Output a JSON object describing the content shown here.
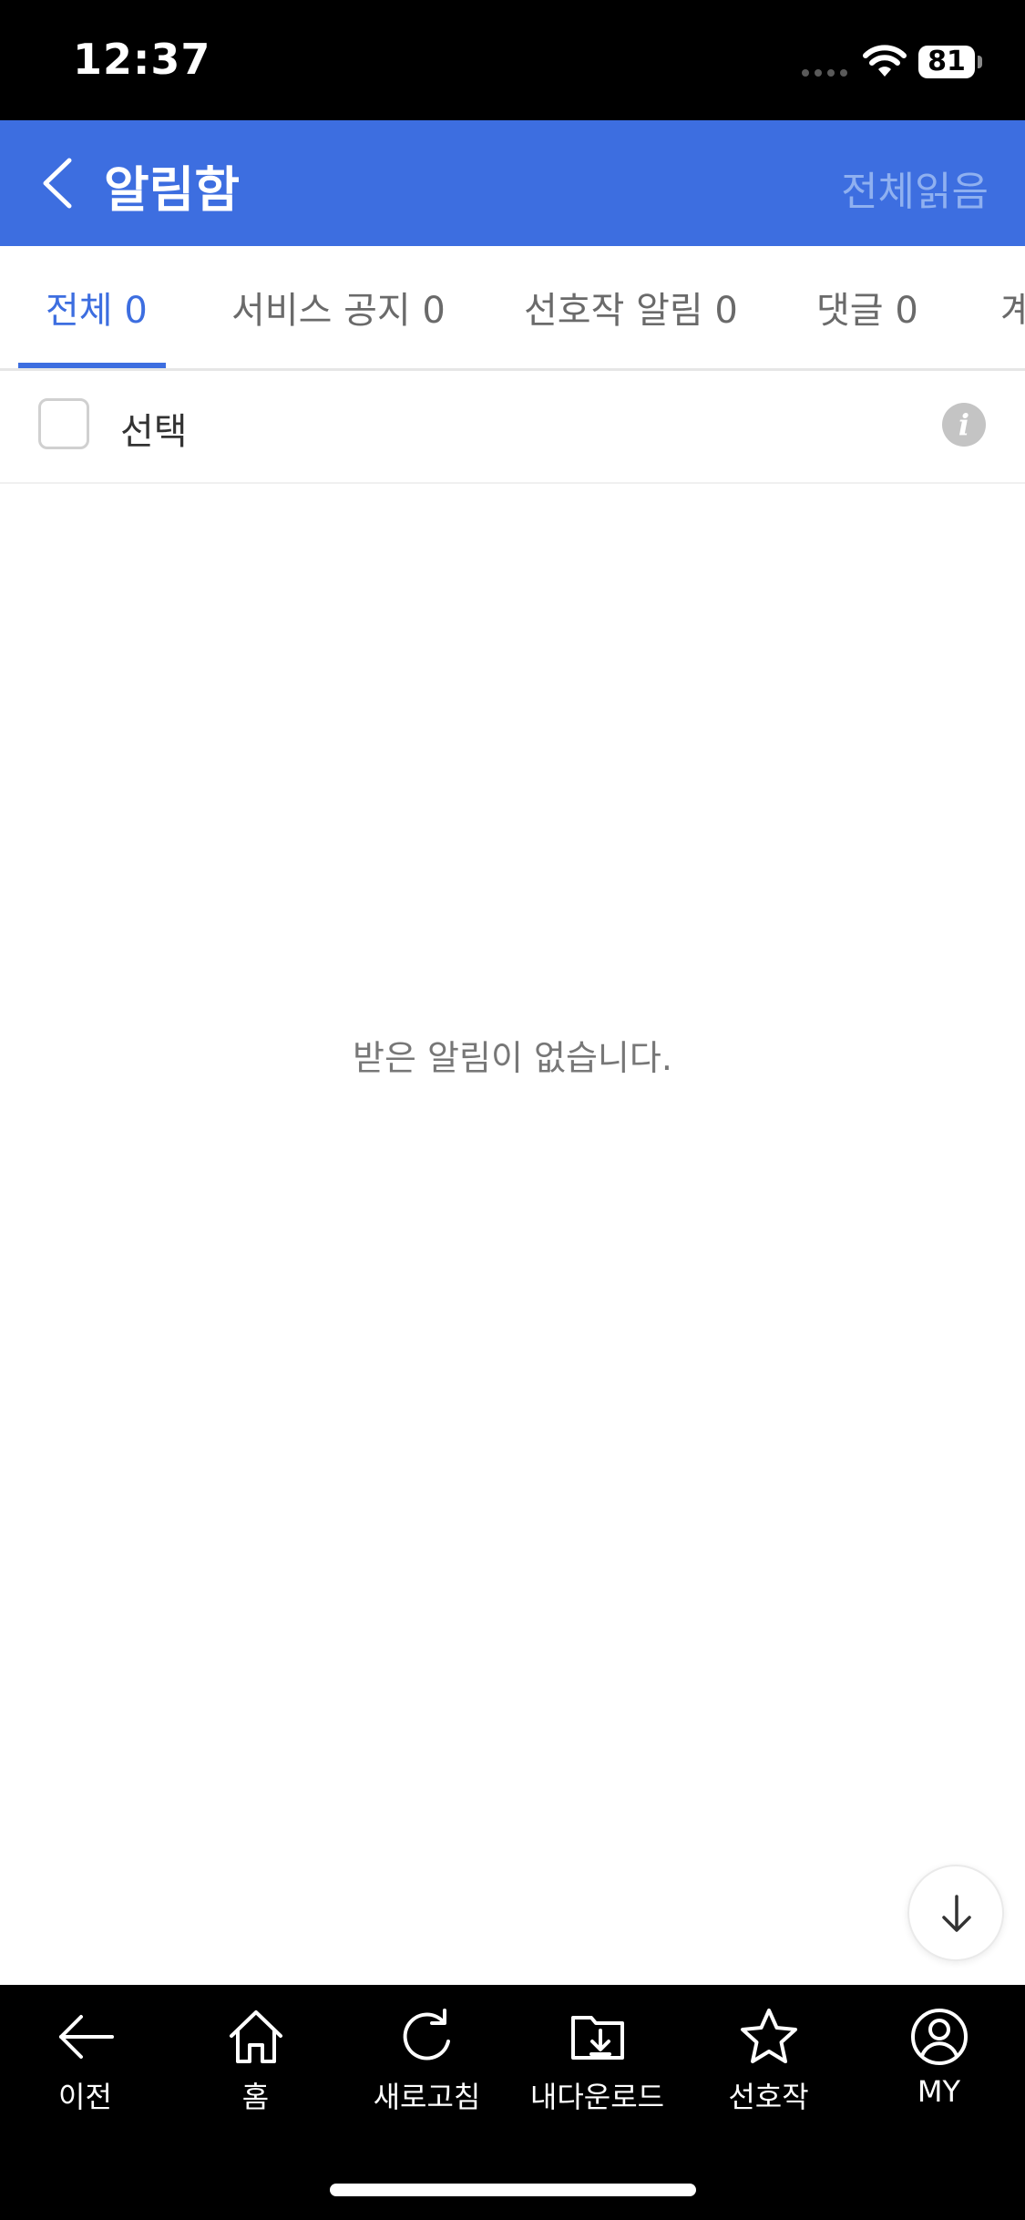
{
  "status_bar": {
    "time": "12:37",
    "battery": "81"
  },
  "header": {
    "title": "알림함",
    "read_all_label": "전체읽음"
  },
  "tabs": [
    {
      "label": "전체 0",
      "active": true
    },
    {
      "label": "서비스 공지 0",
      "active": false
    },
    {
      "label": "선호작 알림 0",
      "active": false
    },
    {
      "label": "댓글 0",
      "active": false
    },
    {
      "label": "계",
      "active": false
    }
  ],
  "select_row": {
    "label": "선택",
    "info_icon": "i"
  },
  "empty_state": {
    "message": "받은 알림이 없습니다."
  },
  "bottom_nav": [
    {
      "label": "이전",
      "icon": "arrow-left-icon"
    },
    {
      "label": "홈",
      "icon": "home-icon"
    },
    {
      "label": "새로고침",
      "icon": "refresh-icon"
    },
    {
      "label": "내다운로드",
      "icon": "download-folder-icon"
    },
    {
      "label": "선호작",
      "icon": "star-icon"
    },
    {
      "label": "MY",
      "icon": "user-icon"
    }
  ],
  "colors": {
    "accent": "#3d6ee0",
    "header_inactive_text": "#8fb0f0",
    "tab_inactive": "#6a6a6a",
    "nav_background": "#000000"
  }
}
